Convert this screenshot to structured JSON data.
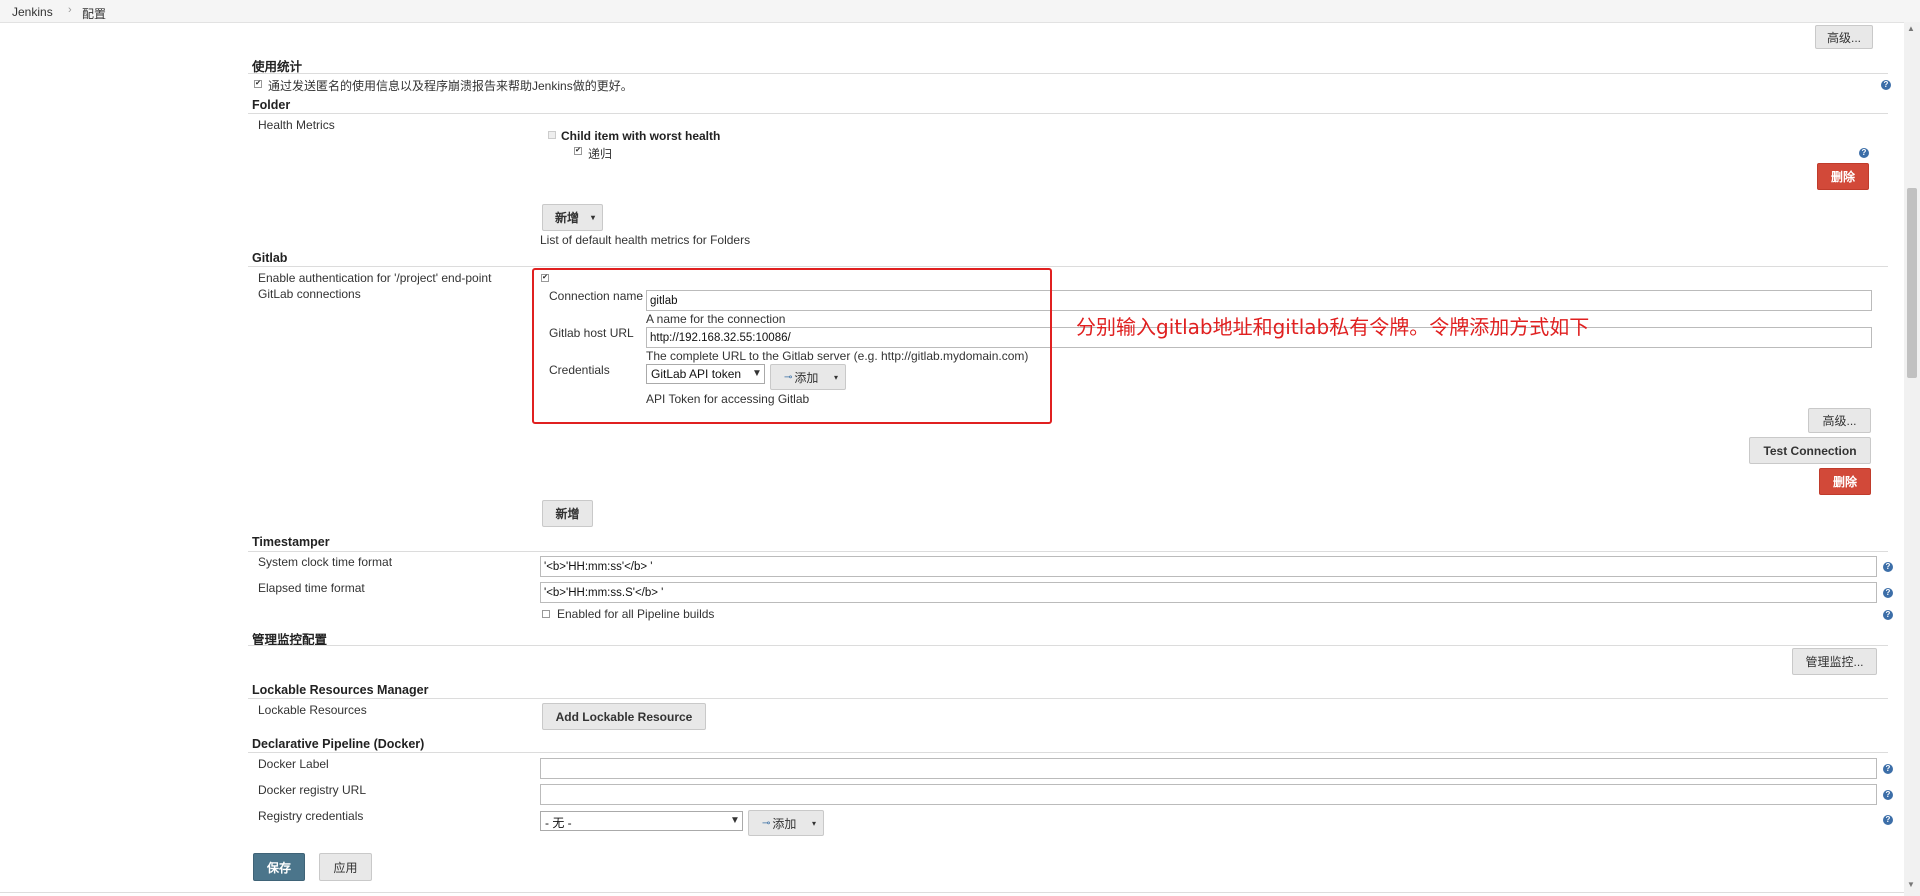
{
  "breadcrumb": {
    "items": [
      "Jenkins",
      "配置"
    ],
    "separator": "›"
  },
  "top_advanced_button": "高级...",
  "usage_stats": {
    "title": "使用统计",
    "checkbox_label": "通过发送匿名的使用信息以及程序崩溃报告来帮助Jenkins做的更好。",
    "checked": true
  },
  "folder": {
    "title": "Folder",
    "health_metrics_label": "Health Metrics",
    "child_item_label": "Child item with worst health",
    "recursive_label": "递归",
    "delete_button": "删除",
    "add_button": "新增",
    "description": "List of default health metrics for Folders"
  },
  "gitlab": {
    "title": "Gitlab",
    "auth_label": "Enable authentication for '/project' end-point",
    "connections_label": "GitLab connections",
    "connection_name_label": "Connection name",
    "connection_name_value": "gitlab",
    "connection_name_help": "A name for the connection",
    "host_url_label": "Gitlab host URL",
    "host_url_value": "http://192.168.32.55:10086/",
    "host_url_help": "The complete URL to the Gitlab server (e.g. http://gitlab.mydomain.com)",
    "credentials_label": "Credentials",
    "credentials_value": "GitLab API token",
    "add_credentials_button": "添加",
    "credentials_help": "API Token for accessing Gitlab",
    "advanced_button": "高级...",
    "test_connection_button": "Test Connection",
    "delete_button": "删除",
    "add_button": "新增"
  },
  "annotation": "分别输入gitlab地址和gitlab私有令牌。令牌添加方式如下",
  "timestamper": {
    "title": "Timestamper",
    "system_clock_label": "System clock time format",
    "system_clock_value": "'<b>'HH:mm:ss'</b> '",
    "elapsed_label": "Elapsed time format",
    "elapsed_value": "'<b>'HH:mm:ss.S'</b> '",
    "pipeline_label": "Enabled for all Pipeline builds"
  },
  "monitoring": {
    "title": "管理监控配置",
    "button": "管理监控..."
  },
  "lockable": {
    "title": "Lockable Resources Manager",
    "label": "Lockable Resources",
    "button": "Add Lockable Resource"
  },
  "docker": {
    "title": "Declarative Pipeline (Docker)",
    "docker_label": "Docker Label",
    "registry_url_label": "Docker registry URL",
    "registry_credentials_label": "Registry credentials",
    "credentials_value": "- 无 -",
    "add_button": "添加"
  },
  "footer": {
    "save_button": "保存",
    "apply_button": "应用"
  },
  "colors": {
    "danger": "#d24939",
    "save": "#4b758b",
    "annotation": "#e02020",
    "help": "#3c6ea8"
  }
}
